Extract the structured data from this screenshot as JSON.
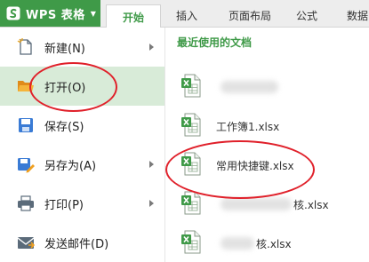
{
  "app": {
    "name": "WPS 表格"
  },
  "tabs": [
    {
      "label": "开始",
      "active": true
    },
    {
      "label": "插入"
    },
    {
      "label": "页面布局"
    },
    {
      "label": "公式"
    },
    {
      "label": "数据"
    }
  ],
  "menu": {
    "items": [
      {
        "label": "新建(N)",
        "icon": "new-document-icon",
        "has_submenu": true
      },
      {
        "label": "打开(O)",
        "icon": "open-folder-icon",
        "has_submenu": false,
        "highlighted": true
      },
      {
        "label": "保存(S)",
        "icon": "save-icon",
        "has_submenu": false
      },
      {
        "label": "另存为(A)",
        "icon": "save-as-icon",
        "has_submenu": true
      },
      {
        "label": "打印(P)",
        "icon": "print-icon",
        "has_submenu": true
      },
      {
        "label": "发送邮件(D)",
        "icon": "mail-icon",
        "has_submenu": false
      }
    ]
  },
  "recent": {
    "title": "最近使用的文档",
    "files": [
      {
        "name": ""
      },
      {
        "name": "工作簿1.xlsx"
      },
      {
        "name": "常用快捷键.xlsx"
      },
      {
        "name": "核.xlsx"
      },
      {
        "name": "核.xlsx"
      }
    ]
  },
  "colors": {
    "accent": "#3f9a48",
    "annotation": "#e0202a",
    "selected_bg": "#d8ebd8"
  }
}
